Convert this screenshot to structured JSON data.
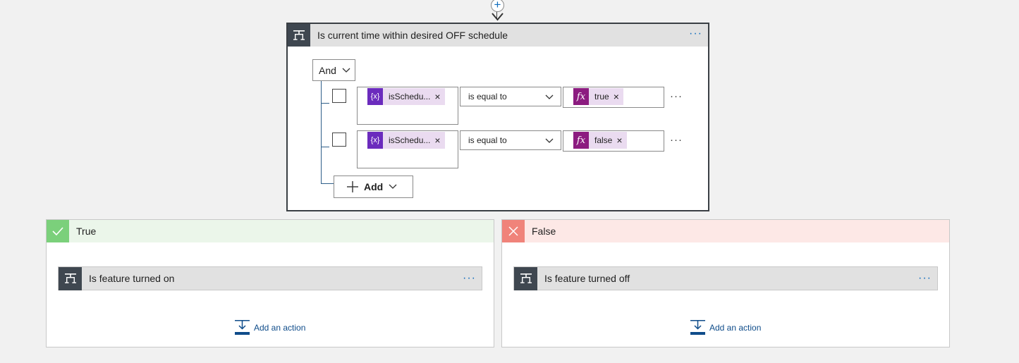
{
  "colors": {
    "accent": "#0f6cbd",
    "header_dark": "#3f4750",
    "variable_token": "#6b2bbd",
    "expression_token": "#8c1c80",
    "true_badge": "#7bd07b",
    "true_header": "#ebf6ea",
    "false_badge": "#f0837a",
    "false_header": "#fde8e6"
  },
  "top_connector": {
    "add_icon": "plus-circle-icon",
    "arrow_icon": "arrow-down-icon"
  },
  "condition": {
    "title": "Is current time within desired OFF schedule",
    "icon": "condition-icon",
    "menu": "···",
    "group_operator": "And",
    "rows": [
      {
        "left_token": {
          "icon": "{x}",
          "label": "isSchedu...",
          "remove": "×"
        },
        "operator": "is equal to",
        "right_token": {
          "icon": "fx",
          "label": "true",
          "remove": "×"
        },
        "menu": "···"
      },
      {
        "left_token": {
          "icon": "{x}",
          "label": "isSchedu...",
          "remove": "×"
        },
        "operator": "is equal to",
        "right_token": {
          "icon": "fx",
          "label": "false",
          "remove": "×"
        },
        "menu": "···"
      }
    ],
    "add_label": "Add"
  },
  "branches": {
    "true": {
      "label": "True",
      "badge_icon": "checkmark-icon",
      "action": {
        "title": "Is feature turned on",
        "menu": "···"
      },
      "add_action": "Add an action"
    },
    "false": {
      "label": "False",
      "badge_icon": "close-icon",
      "action": {
        "title": "Is feature turned off",
        "menu": "···"
      },
      "add_action": "Add an action"
    }
  }
}
